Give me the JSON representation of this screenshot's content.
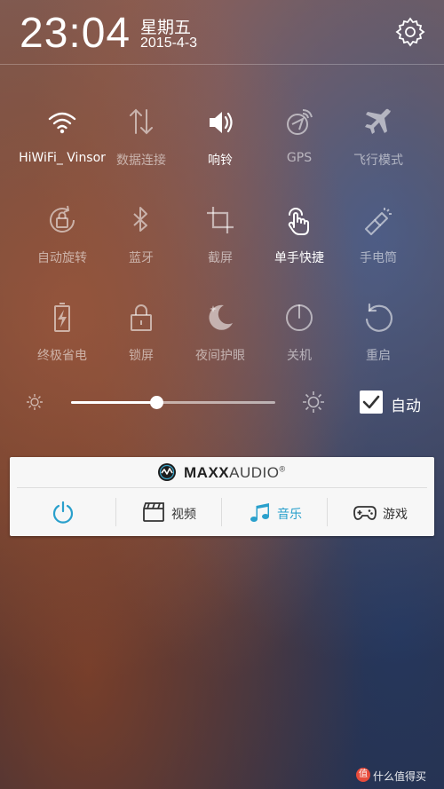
{
  "header": {
    "time": "23:04",
    "weekday": "星期五",
    "date": "2015-4-3",
    "settings_icon": "gear-icon"
  },
  "toggles": [
    {
      "label": "HiWiFi_ Vinsor",
      "icon": "wifi-icon",
      "state": "on"
    },
    {
      "label": "数据连接",
      "icon": "data-transfer-icon",
      "state": "off"
    },
    {
      "label": "响铃",
      "icon": "speaker-icon",
      "state": "on"
    },
    {
      "label": "GPS",
      "icon": "gps-icon",
      "state": "off"
    },
    {
      "label": "飞行模式",
      "icon": "airplane-icon",
      "state": "off"
    },
    {
      "label": "自动旋转",
      "icon": "auto-rotate-icon",
      "state": "off"
    },
    {
      "label": "蓝牙",
      "icon": "bluetooth-icon",
      "state": "off"
    },
    {
      "label": "截屏",
      "icon": "crop-icon",
      "state": "off"
    },
    {
      "label": "单手快捷",
      "icon": "hand-tap-icon",
      "state": "on"
    },
    {
      "label": "手电筒",
      "icon": "flashlight-icon",
      "state": "off"
    },
    {
      "label": "终极省电",
      "icon": "battery-saver-icon",
      "state": "off"
    },
    {
      "label": "锁屏",
      "icon": "lock-icon",
      "state": "off"
    },
    {
      "label": "夜间护眼",
      "icon": "moon-icon",
      "state": "off"
    },
    {
      "label": "关机",
      "icon": "power-icon",
      "state": "off"
    },
    {
      "label": "重启",
      "icon": "restart-icon",
      "state": "off"
    }
  ],
  "brightness": {
    "level": 0.42,
    "auto_checked": true,
    "auto_label": "自动"
  },
  "maxxaudio": {
    "brand_bold": "MAXX",
    "brand_thin": "AUDIO",
    "registered": "®",
    "accent_color": "#2aa0cc",
    "modes": [
      {
        "label": "",
        "icon": "power-icon",
        "active": true
      },
      {
        "label": "视频",
        "icon": "film-clapper-icon",
        "active": false
      },
      {
        "label": "音乐",
        "icon": "music-note-icon",
        "active": true
      },
      {
        "label": "游戏",
        "icon": "gamepad-icon",
        "active": false
      }
    ]
  },
  "watermark": {
    "icon_text": "值",
    "text": "什么值得买"
  }
}
